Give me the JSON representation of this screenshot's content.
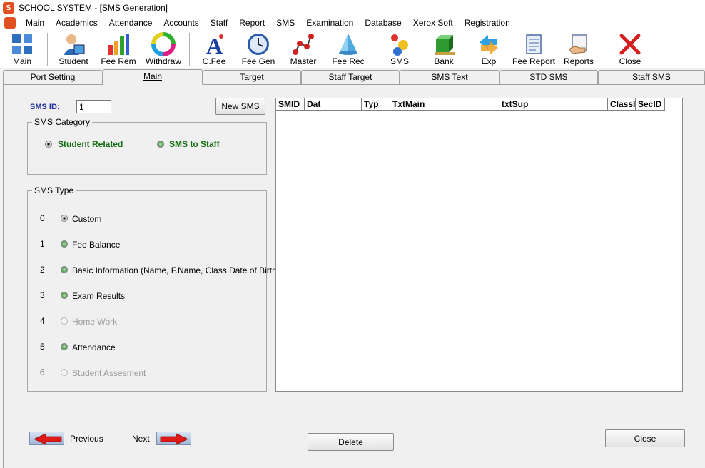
{
  "window": {
    "title": "SCHOOL SYSTEM - [SMS Generation]"
  },
  "menu": [
    "Main",
    "Academics",
    "Attendance",
    "Accounts",
    "Staff",
    "Report",
    "SMS",
    "Examination",
    "Database",
    "Xerox Soft",
    "Registration"
  ],
  "toolbar": [
    {
      "label": "Main",
      "icon": "main-grid-icon"
    },
    {
      "label": "Student",
      "icon": "student-icon"
    },
    {
      "label": "Fee Rem",
      "icon": "bar-chart-icon"
    },
    {
      "label": "Withdraw",
      "icon": "color-wheel-icon"
    },
    {
      "label": "C.Fee",
      "icon": "font-a-icon"
    },
    {
      "label": "Fee Gen",
      "icon": "clock-icon"
    },
    {
      "label": "Master",
      "icon": "graph-icon"
    },
    {
      "label": "Fee Rec",
      "icon": "pyramid-icon"
    },
    {
      "label": "SMS",
      "icon": "dots-icon"
    },
    {
      "label": "Bank",
      "icon": "bank-cube-icon"
    },
    {
      "label": "Exp",
      "icon": "exchange-arrows-icon"
    },
    {
      "label": "Fee Report",
      "icon": "scroll-icon"
    },
    {
      "label": "Reports",
      "icon": "reports-hand-icon"
    },
    {
      "label": "Close",
      "icon": "close-x-icon"
    }
  ],
  "tabs": [
    "Port Setting",
    "Main",
    "Target",
    "Staff Target",
    "SMS Text",
    "STD SMS",
    "Staff SMS"
  ],
  "active_tab": "Main",
  "form": {
    "sms_id_label": "SMS ID:",
    "sms_id_value": "1",
    "new_sms_button": "New SMS"
  },
  "category": {
    "title": "SMS  Category",
    "options": [
      "Student Related",
      "SMS to Staff"
    ],
    "selected": "Student Related"
  },
  "sms_type": {
    "title": "SMS Type",
    "options": [
      {
        "num": "0",
        "label": "Custom",
        "state": "checked"
      },
      {
        "num": "1",
        "label": "Fee Balance",
        "state": "enabled"
      },
      {
        "num": "2",
        "label": "Basic Information (Name, F.Name, Class  Date of Birth)",
        "state": "enabled"
      },
      {
        "num": "3",
        "label": "Exam Results",
        "state": "enabled"
      },
      {
        "num": "4",
        "label": "Home Work",
        "state": "disabled"
      },
      {
        "num": "5",
        "label": "Attendance",
        "state": "enabled"
      },
      {
        "num": "6",
        "label": "Student Assesment",
        "state": "disabled"
      }
    ]
  },
  "grid": {
    "columns": [
      "SMID",
      "Dat",
      "Typ",
      "TxtMain",
      "txtSup",
      "ClassI",
      "SecID"
    ]
  },
  "nav": {
    "previous": "Previous",
    "next": "Next"
  },
  "buttons": {
    "delete": "Delete",
    "close": "Close"
  },
  "colors": {
    "sms_id_label": "#1b2b9a",
    "category_text": "#106a10",
    "disabled_text": "#9a9a9a",
    "nav_arrow": "#e01818"
  }
}
